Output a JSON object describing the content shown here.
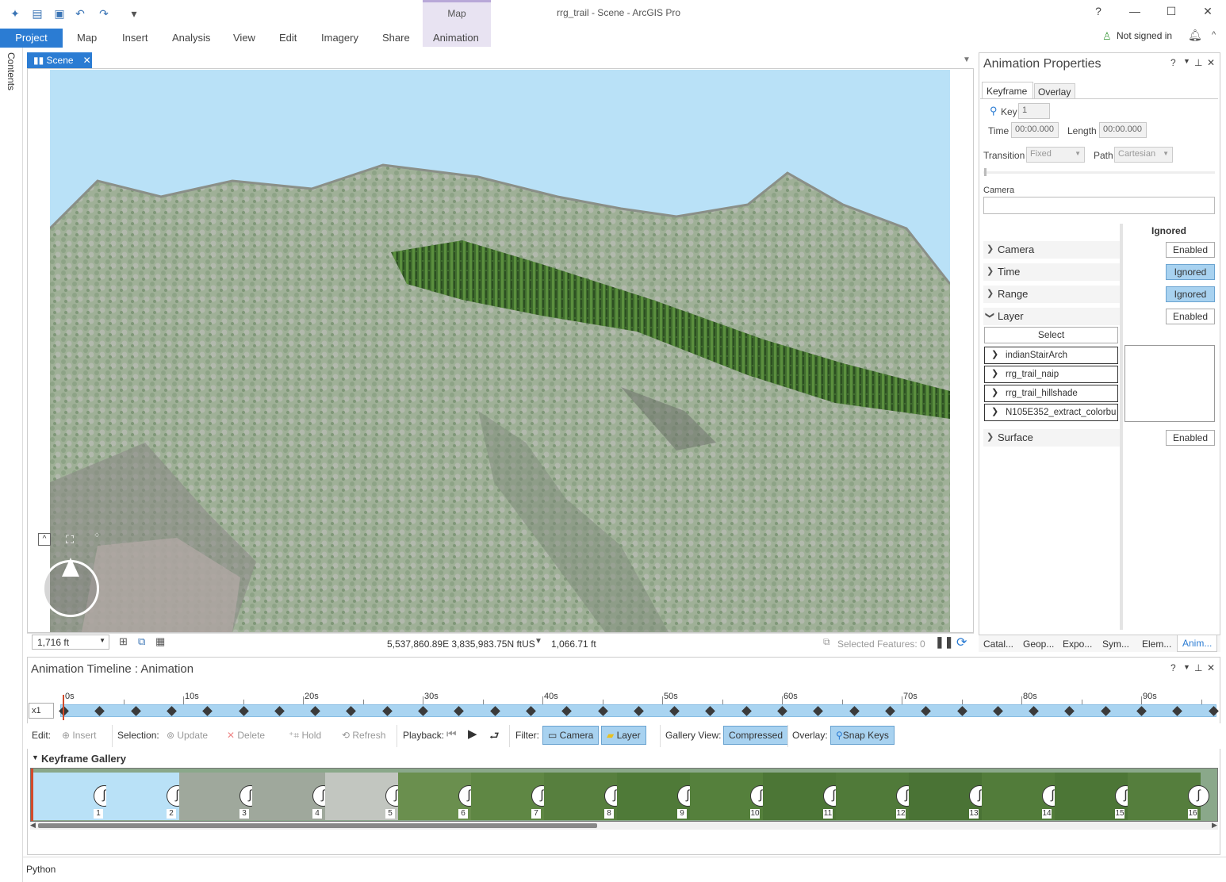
{
  "window": {
    "title": "rrg_trail - Scene - ArcGIS Pro",
    "help": "?",
    "minimize": "—",
    "maximize": "☐",
    "close": "✕"
  },
  "ribbon": {
    "context_group": "Map",
    "tabs": [
      "Project",
      "Map",
      "Insert",
      "Analysis",
      "View",
      "Edit",
      "Imagery",
      "Share",
      "Animation"
    ],
    "signin": "Not signed in"
  },
  "left_strip": {
    "contents": "Contents"
  },
  "scene": {
    "tab_label": "Scene",
    "scale": "1,716 ft",
    "coordinates": "5,537,860.89E 3,835,983.75N ftUS",
    "elevation": "1,066.71 ft",
    "selected_features": "Selected Features: 0"
  },
  "props": {
    "title": "Animation Properties",
    "tabs": [
      "Keyframe",
      "Overlay"
    ],
    "key_label": "Key",
    "key_value": "1",
    "time_label": "Time",
    "time_value": "00:00.000",
    "length_label": "Length",
    "length_value": "00:00.000",
    "transition_label": "Transition",
    "transition_value": "Fixed",
    "path_label": "Path",
    "path_value": "Cartesian",
    "camera_label": "Camera",
    "col_header": "Ignored",
    "groups": [
      {
        "label": "Camera",
        "state": "Enabled",
        "on": false
      },
      {
        "label": "Time",
        "state": "Ignored",
        "on": true
      },
      {
        "label": "Range",
        "state": "Ignored",
        "on": true
      },
      {
        "label": "Layer",
        "state": "Enabled",
        "on": false
      },
      {
        "label": "Surface",
        "state": "Enabled",
        "on": false
      }
    ],
    "select_btn": "Select",
    "layers": [
      "indianStairArch",
      "rrg_trail_naip",
      "rrg_trail_hillshade",
      "N105E352_extract_colorbu"
    ],
    "bottom_tabs": [
      "Catal...",
      "Geop...",
      "Expo...",
      "Sym...",
      "Elem...",
      "Anim..."
    ]
  },
  "timeline": {
    "title": "Animation Timeline : Animation",
    "speed": "x1",
    "ticks": [
      "0s",
      "10s",
      "20s",
      "30s",
      "40s",
      "50s",
      "60s",
      "70s",
      "80s",
      "90s"
    ],
    "toolbar": {
      "edit": "Edit:",
      "insert": "Insert",
      "selection": "Selection:",
      "update": "Update",
      "delete": "Delete",
      "hold": "Hold",
      "refresh": "Refresh",
      "playback": "Playback:",
      "filter": "Filter:",
      "camera": "Camera",
      "layer": "Layer",
      "gallery_view": "Gallery View:",
      "compressed": "Compressed",
      "overlay": "Overlay:",
      "snap_keys": "Snap Keys"
    },
    "gallery_title": "Keyframe Gallery",
    "frames": [
      "1",
      "2",
      "3",
      "4",
      "5",
      "6",
      "7",
      "8",
      "9",
      "10",
      "11",
      "12",
      "13",
      "14",
      "15",
      "16"
    ]
  },
  "footer": {
    "python": "Python"
  },
  "colors": {
    "accent": "#2b7cd3",
    "toggle_on": "#a8d2f0",
    "track": "#a9d4f1",
    "sky": "#b9e1f7"
  }
}
